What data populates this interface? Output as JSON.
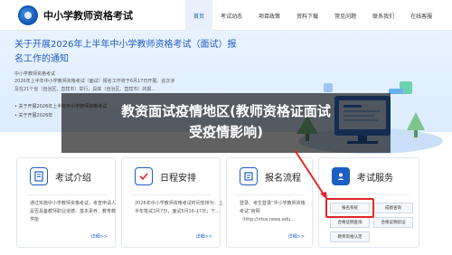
{
  "header": {
    "site_title": "中小学教师资格考试",
    "nav": [
      {
        "label": "首页",
        "active": true
      },
      {
        "label": "考试动态",
        "active": false
      },
      {
        "label": "项目政策",
        "active": false
      },
      {
        "label": "资料下载",
        "active": false
      },
      {
        "label": "常见问题",
        "active": false
      },
      {
        "label": "联系我们",
        "active": false
      },
      {
        "label": "在线客服",
        "active": false
      }
    ]
  },
  "banner": {
    "title": "关于开展2026年上半年中小学教师资格考试（面试）报名工作的通知",
    "breadcrumb": "中小学教师资格考试",
    "blurb": "2026年上半年中小学教师资格考试（面试）报名工作将于6月17日开展。此次涉及在21个省（自治区、直辖市）举行，具体（自治区、直辖市）的报...",
    "bullets": [
      "关于开展2026年上半年中小学教师资格考试",
      "关于开展2026年"
    ]
  },
  "overlay": {
    "line1": "教资面试疫情地区(教师资格证面试",
    "line2": "受疫情影响)"
  },
  "cards": [
    {
      "title": "考试介绍",
      "body": "通过实施中小学教师资格考试，考查申请人是否具备教师职业道德、基本素养、教育教学能",
      "more": "详细>>"
    },
    {
      "title": "日程安排",
      "body": "2026年中小学教师资格考试时间安排为：上半年笔试3月7日，面试5月16-17日；下...",
      "more": "详细>>"
    },
    {
      "title": "报名流程",
      "body": "登录、考生登录“中小学教师资格考试”官网（http://ntce.neea.edu...",
      "more": "详细>>"
    },
    {
      "title": "考试服务"
    }
  ],
  "services": {
    "buttons": [
      "报名系统",
      "成绩查询",
      "合格证明查询",
      "合格证明验证",
      "教师资格认定"
    ]
  },
  "colors": {
    "accent": "#1c5fc4",
    "highlight": "#e3262b"
  }
}
